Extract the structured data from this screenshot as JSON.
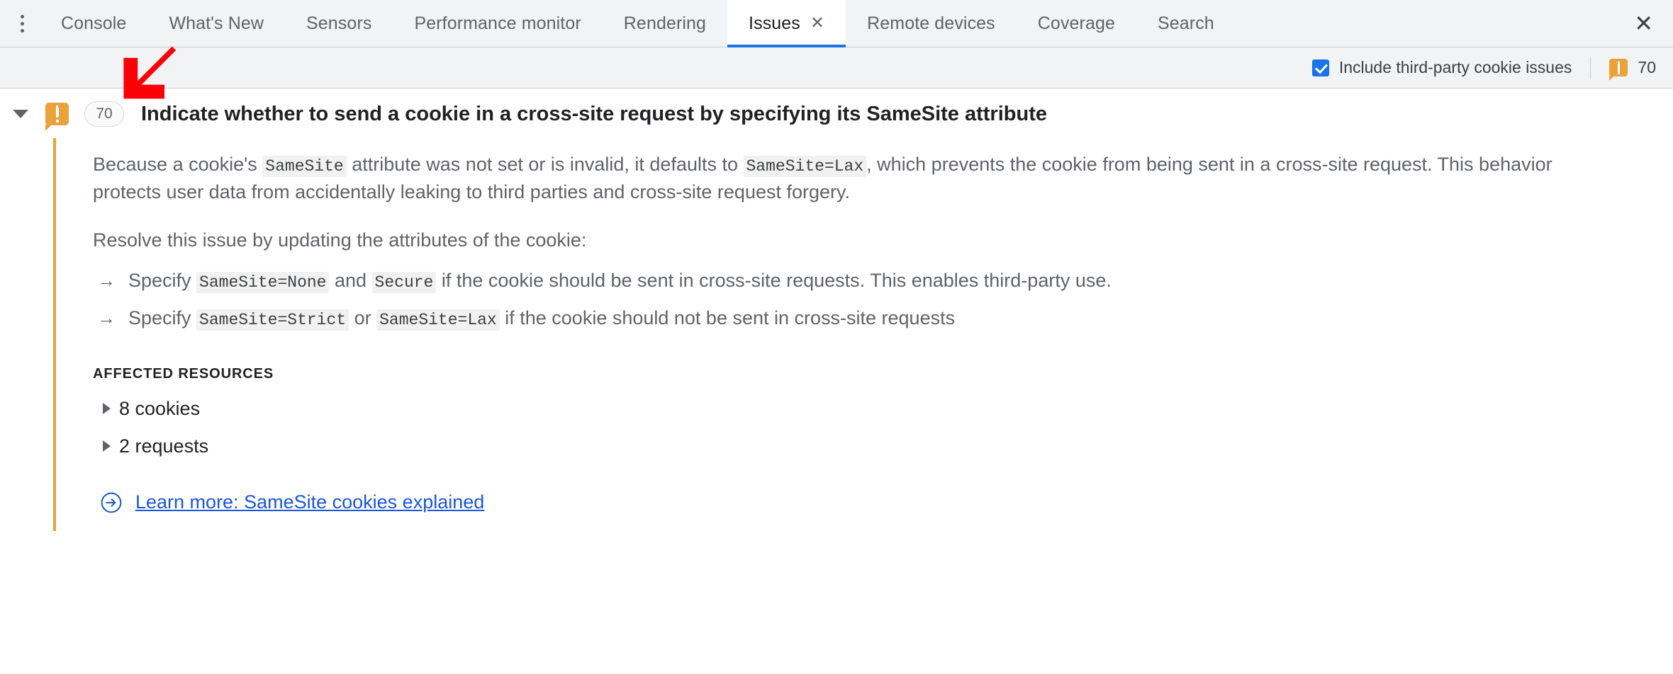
{
  "tabbar": {
    "menu_icon": "kebab-menu-icon",
    "close_icon": "close-icon",
    "close_glyph": "✕",
    "tab_close_glyph": "✕",
    "tabs": [
      {
        "label": "Console",
        "active": false,
        "closable": false
      },
      {
        "label": "What's New",
        "active": false,
        "closable": false
      },
      {
        "label": "Sensors",
        "active": false,
        "closable": false
      },
      {
        "label": "Performance monitor",
        "active": false,
        "closable": false
      },
      {
        "label": "Rendering",
        "active": false,
        "closable": false
      },
      {
        "label": "Issues",
        "active": true,
        "closable": true
      },
      {
        "label": "Remote devices",
        "active": false,
        "closable": false
      },
      {
        "label": "Coverage",
        "active": false,
        "closable": false
      },
      {
        "label": "Search",
        "active": false,
        "closable": false
      }
    ]
  },
  "toolbar": {
    "checkbox_label": "Include third-party cookie issues",
    "checkbox_checked": true,
    "issue_count": "70",
    "warning_icon": "warning-icon"
  },
  "issue": {
    "expanded": true,
    "count_badge": "70",
    "title": "Indicate whether to send a cookie in a cross-site request by specifying its SameSite attribute",
    "paragraph1": [
      {
        "t": "text",
        "v": "Because a cookie's "
      },
      {
        "t": "code",
        "v": "SameSite"
      },
      {
        "t": "text",
        "v": " attribute was not set or is invalid, it defaults to "
      },
      {
        "t": "code",
        "v": "SameSite=Lax"
      },
      {
        "t": "text",
        "v": ", which prevents the cookie from being sent in a cross-site request. This behavior protects user data from accidentally leaking to third parties and cross-site request forgery."
      }
    ],
    "resolve_line": "Resolve this issue by updating the attributes of the cookie:",
    "arrow_glyph": "→",
    "bullets": [
      [
        {
          "t": "text",
          "v": "Specify "
        },
        {
          "t": "code",
          "v": "SameSite=None"
        },
        {
          "t": "text",
          "v": " and "
        },
        {
          "t": "code",
          "v": "Secure"
        },
        {
          "t": "text",
          "v": " if the cookie should be sent in cross-site requests. This enables third-party use."
        }
      ],
      [
        {
          "t": "text",
          "v": "Specify "
        },
        {
          "t": "code",
          "v": "SameSite=Strict"
        },
        {
          "t": "text",
          "v": " or "
        },
        {
          "t": "code",
          "v": "SameSite=Lax"
        },
        {
          "t": "text",
          "v": " if the cookie should not be sent in cross-site requests"
        }
      ]
    ],
    "affected_resources_title": "AFFECTED RESOURCES",
    "resources": [
      {
        "label": "8 cookies"
      },
      {
        "label": "2 requests"
      }
    ],
    "learn_more_label": "Learn more: SameSite cookies explained",
    "learn_more_icon": "circled-arrow-right-icon"
  },
  "annotation": {
    "arrow_icon": "red-pointer-arrow",
    "color": "#fb0007"
  },
  "colors": {
    "accent": "#1a73e8",
    "warning": "#e9a33a",
    "link": "#1a56d8",
    "toolbar_bg": "#f1f3f4",
    "text": "#202124",
    "muted_text": "#5f6368"
  }
}
